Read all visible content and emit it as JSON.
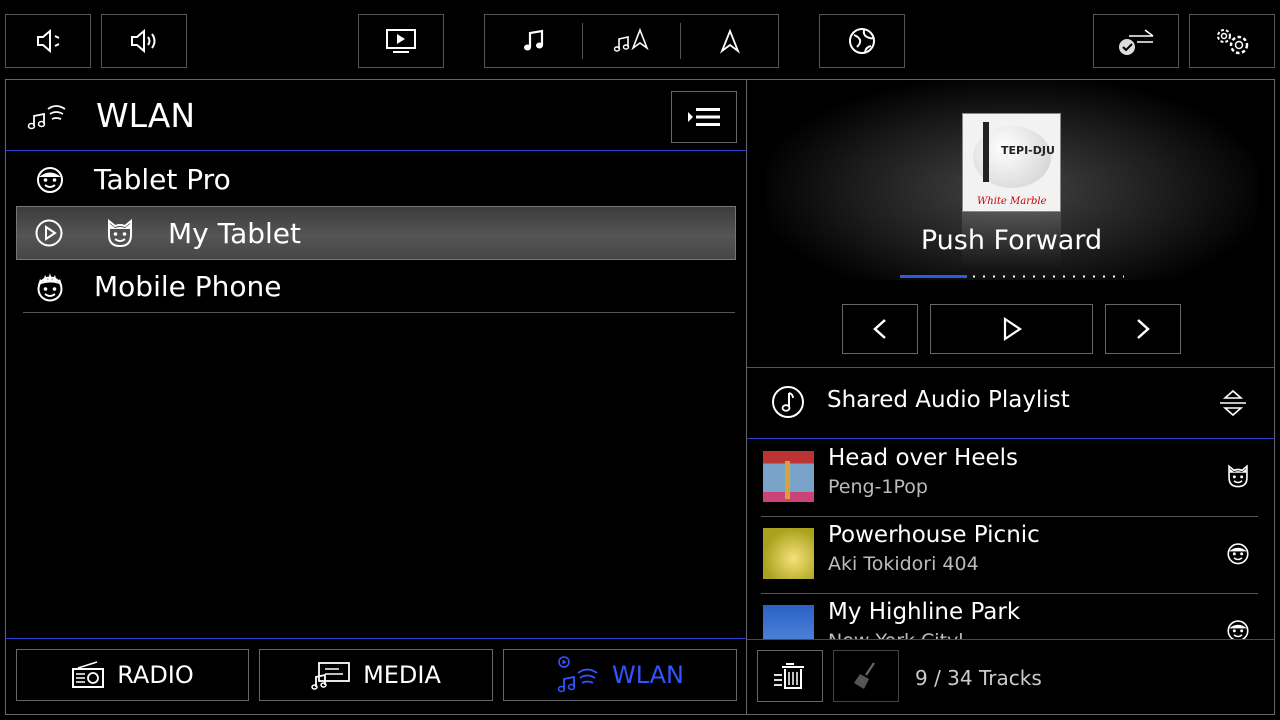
{
  "top_bar": {
    "mute_icon": "mute-icon",
    "volume_icon": "volume-icon",
    "video_icon": "video-icon",
    "music_icon": "music-icon",
    "music_nav_icon": "music-nav-icon",
    "nav_icon": "navigation-icon",
    "globe_icon": "globe-icon",
    "connect_icon": "connection-check-icon",
    "settings_icon": "settings-icon"
  },
  "left": {
    "title": "WLAN",
    "devices": [
      {
        "name": "Tablet Pro",
        "icon": "user-face-icon",
        "selected": false
      },
      {
        "name": "My Tablet",
        "icon": "cat-face-icon",
        "selected": true
      },
      {
        "name": "Mobile Phone",
        "icon": "spiky-face-icon",
        "selected": false
      }
    ],
    "sources": [
      {
        "label": "RADIO",
        "icon": "radio-icon",
        "active": false
      },
      {
        "label": "MEDIA",
        "icon": "media-icon",
        "active": false
      },
      {
        "label": "WLAN",
        "icon": "wlan-music-icon",
        "active": true
      }
    ]
  },
  "player": {
    "album_text_top": "TEPI-DJU",
    "album_text_bottom": "White Marble",
    "track_title": "Push Forward",
    "progress": 0.3
  },
  "playlist": {
    "title": "Shared Audio Playlist",
    "tracks": [
      {
        "title": "Head over Heels",
        "artist": "Peng-1Pop",
        "icon": "cat-face-icon"
      },
      {
        "title": "Powerhouse Picnic",
        "artist": "Aki Tokidori 404",
        "icon": "user-face-icon"
      },
      {
        "title": "My Highline Park",
        "artist": "New York Cityl...",
        "icon": "user-face-icon"
      }
    ],
    "track_count": "9 / 34 Tracks"
  },
  "colors": {
    "accent": "#2a3fcf",
    "active_text": "#3355ff",
    "border": "#666666"
  }
}
